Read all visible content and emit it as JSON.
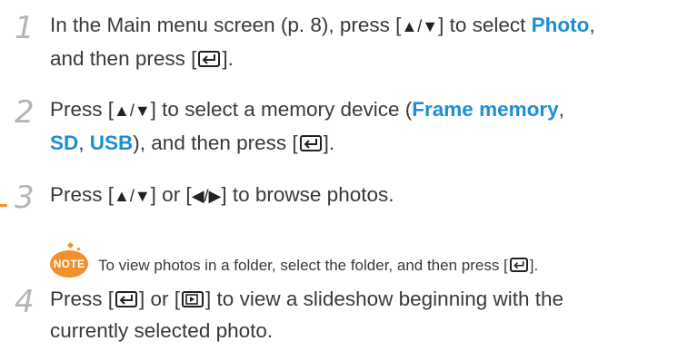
{
  "steps": [
    {
      "number": "1",
      "line1_pre": "In the Main menu screen (p. 8), press [",
      "line1_arrows": "▲/▼",
      "line1_mid": "] to select ",
      "line1_highlight": "Photo",
      "line1_post": ",",
      "line2_pre": "and then press [",
      "line2_post": "]."
    },
    {
      "number": "2",
      "line1_pre": "Press [",
      "line1_arrows": "▲/▼",
      "line1_mid": "] to select a memory device (",
      "line1_highlight": "Frame memory",
      "line1_post": ",",
      "line2_hl1": "SD",
      "line2_sep": ", ",
      "line2_hl2": "USB",
      "line2_pre": "), and then press [",
      "line2_post": "]."
    },
    {
      "number": "3",
      "line1_pre": "Press [",
      "line1_arrows": "▲/▼",
      "line1_mid": "] or [",
      "line1_arrows2": "◀/▶",
      "line1_post": "] to browse photos."
    },
    {
      "number": "4",
      "line1_pre": "Press [",
      "line1_mid": "] or [",
      "line1_post": "] to view a slideshow beginning with the",
      "line2": "currently selected photo."
    }
  ],
  "note": {
    "badge": "NOTE",
    "text_pre": "To view photos in a folder, select the folder, and then press [",
    "text_post": "]."
  },
  "colors": {
    "highlight": "#1a8fd6",
    "accent": "#f2902d",
    "step_number": "#b5b5b5",
    "body_text": "#3a3a3a"
  },
  "icons": [
    "enter-key-icon",
    "slideshow-key-icon",
    "note-badge-icon"
  ]
}
